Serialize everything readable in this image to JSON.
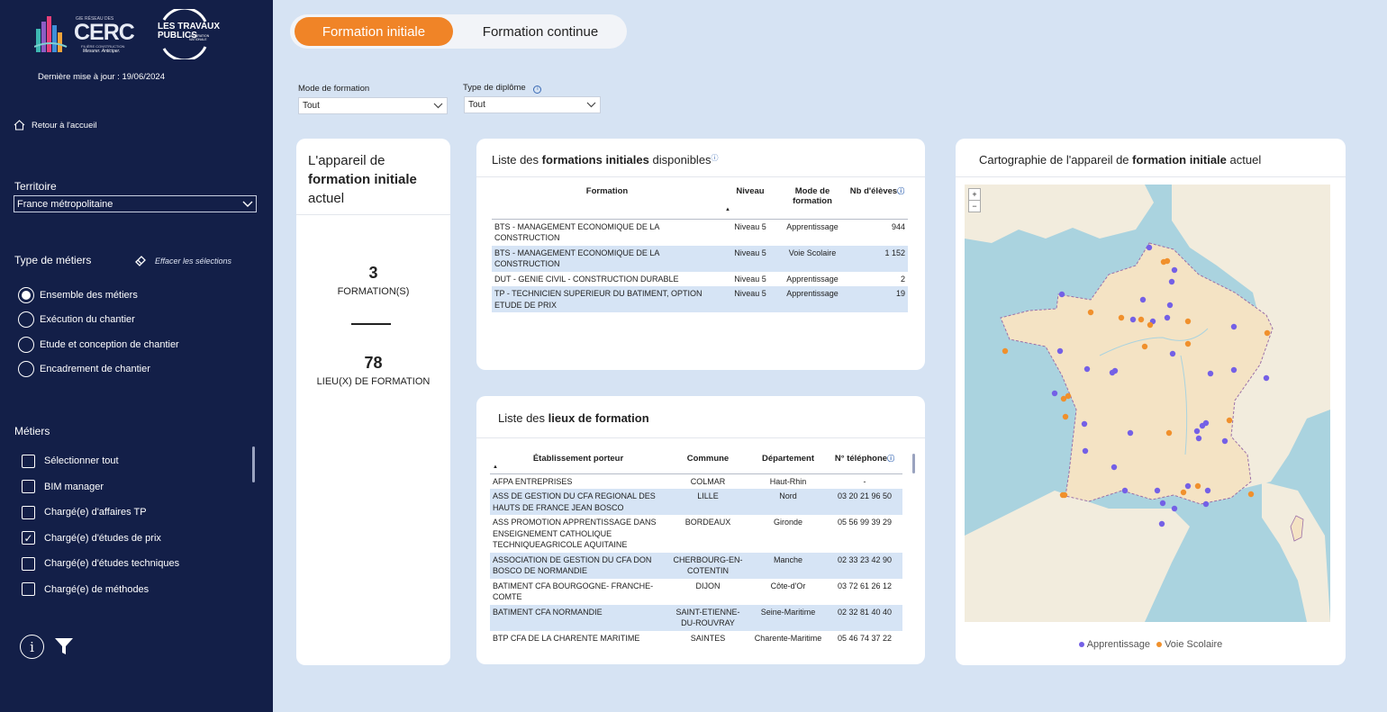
{
  "sidebar": {
    "last_update": "Dernière mise à jour :  19/06/2024",
    "home_link": "Retour à l'accueil",
    "territory_label": "Territoire",
    "territory_value": "France métropolitaine",
    "job_type_label": "Type de métiers",
    "clear_selection": "Effacer les sélections",
    "job_types": [
      {
        "label": "Ensemble des métiers",
        "selected": true
      },
      {
        "label": "Exécution du chantier",
        "selected": false
      },
      {
        "label": "Etude et conception de chantier",
        "selected": false
      },
      {
        "label": "Encadrement de chantier",
        "selected": false
      }
    ],
    "jobs_label": "Métiers",
    "jobs": [
      {
        "label": "Sélectionner tout",
        "checked": false
      },
      {
        "label": "BIM manager",
        "checked": false
      },
      {
        "label": "Chargé(e) d'affaires TP",
        "checked": false
      },
      {
        "label": "Chargé(e) d'études de prix",
        "checked": true
      },
      {
        "label": "Chargé(e) d'études techniques",
        "checked": false
      },
      {
        "label": "Chargé(e) de méthodes",
        "checked": false
      }
    ],
    "info_icon": "info-icon",
    "filter_icon": "filter-icon"
  },
  "logos": {
    "cerc_top": "GIE RÉSEAU DES",
    "cerc_main": "CERC",
    "cerc_sub": "FILIÈRE CONSTRUCTION",
    "cerc_tagline": "Mesurer. Anticiper.",
    "tp_line1": "LES TRAVAUX",
    "tp_line2": "PUBLICS",
    "tp_side": "FÉDÉRATION NATIONALE"
  },
  "toggle": {
    "active": "Formation initiale",
    "inactive": "Formation continue"
  },
  "filters": {
    "mode_label": "Mode de formation",
    "mode_value": "Tout",
    "diploma_label": "Type de diplôme",
    "diploma_value": "Tout"
  },
  "kpi": {
    "title_pre": "L'appareil de",
    "title_bold": "formation initiale",
    "title_post": "actuel",
    "formations_value": "3",
    "formations_label": "FORMATION(S)",
    "places_value": "78",
    "places_label": "LIEU(X) DE FORMATION"
  },
  "formations_table": {
    "title_pre": "Liste des",
    "title_bold": "formations initiales",
    "title_post": "disponibles",
    "columns": [
      "Formation",
      "Niveau",
      "Mode de formation",
      "Nb d'élèves"
    ],
    "rows": [
      [
        "BTS - MANAGEMENT ECONOMIQUE DE LA CONSTRUCTION",
        "Niveau 5",
        "Apprentissage",
        "944"
      ],
      [
        "BTS - MANAGEMENT ECONOMIQUE DE LA CONSTRUCTION",
        "Niveau 5",
        "Voie Scolaire",
        "1 152"
      ],
      [
        "DUT - GENIE CIVIL - CONSTRUCTION DURABLE",
        "Niveau 5",
        "Apprentissage",
        "2"
      ],
      [
        "TP - TECHNICIEN SUPERIEUR DU BATIMENT, OPTION ETUDE DE PRIX",
        "Niveau 5",
        "Apprentissage",
        "19"
      ]
    ]
  },
  "places_table": {
    "title_pre": "Liste des",
    "title_bold": "lieux de formation",
    "columns": [
      "Établissement porteur",
      "Commune",
      "Département",
      "N° téléphone"
    ],
    "rows": [
      [
        "AFPA ENTREPRISES",
        "COLMAR",
        "Haut-Rhin",
        "-"
      ],
      [
        "ASS DE GESTION DU CFA REGIONAL DES HAUTS DE FRANCE JEAN BOSCO",
        "LILLE",
        "Nord",
        "03 20 21 96 50"
      ],
      [
        "ASS PROMOTION APPRENTISSAGE DANS ENSEIGNEMENT CATHOLIQUE TECHNIQUEAGRICOLE AQUITAINE",
        "BORDEAUX",
        "Gironde",
        "05 56 99 39 29"
      ],
      [
        "ASSOCIATION DE GESTION DU CFA DON BOSCO DE NORMANDIE",
        "CHERBOURG-EN-COTENTIN",
        "Manche",
        "02 33 23 42 90"
      ],
      [
        "BATIMENT CFA BOURGOGNE- FRANCHE-COMTE",
        "DIJON",
        "Côte-d'Or",
        "03 72 61 26 12"
      ],
      [
        "BATIMENT CFA NORMANDIE",
        "SAINT-ETIENNE-DU-ROUVRAY",
        "Seine-Maritime",
        "02 32 81 40 40"
      ],
      [
        "BTP CFA DE LA CHARENTE MARITIME",
        "SAINTES",
        "Charente-Maritime",
        "05 46 74 37 22"
      ]
    ]
  },
  "map": {
    "title_pre": "Cartographie de l'appareil de",
    "title_bold": "formation initiale",
    "title_post": "actuel",
    "zoom_in": "+",
    "zoom_out": "−",
    "legend": [
      {
        "label": "Apprentissage",
        "color": "#7460e6"
      },
      {
        "label": "Voie Scolaire",
        "color": "#f0902c"
      }
    ],
    "land_color": "#f2e8d3",
    "sea_color": "#aad3df",
    "france_color": "#f4e3c4",
    "border_color": "#9b6fa8"
  },
  "colors": {
    "sidebar_bg": "#131f48",
    "accent": "#f08427",
    "page_bg": "#d6e3f3",
    "row_alt": "#d6e4f5"
  }
}
